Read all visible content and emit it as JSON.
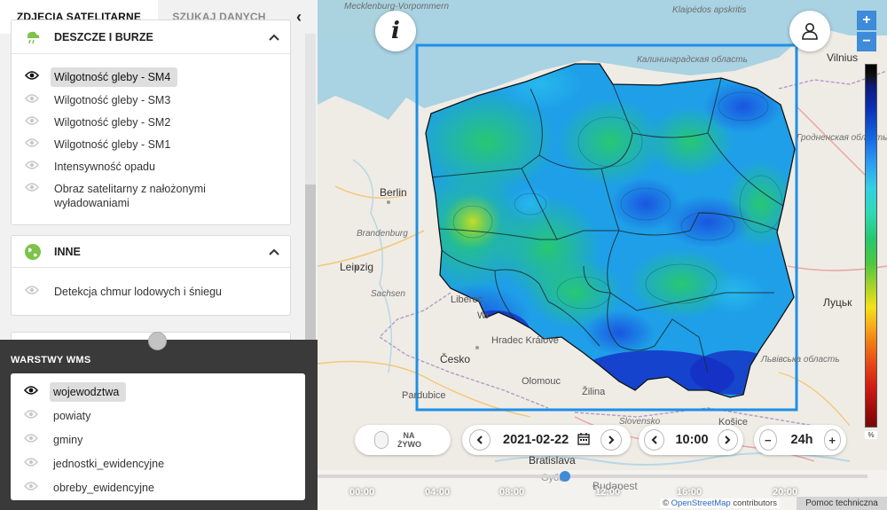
{
  "tabs": {
    "satellite": "ZDJĘCIA SATELITARNE",
    "search": "SZUKAJ DANYCH",
    "collapse": "‹"
  },
  "sections": {
    "rain": {
      "title": "DESZCZE I BURZE",
      "icon": "rain-cloud-icon",
      "layers": [
        {
          "label": "Wilgotność gleby - SM4",
          "active": true
        },
        {
          "label": "Wilgotność gleby - SM3",
          "active": false
        },
        {
          "label": "Wilgotność gleby - SM2",
          "active": false
        },
        {
          "label": "Wilgotność gleby - SM1",
          "active": false
        },
        {
          "label": "Intensywność opadu",
          "active": false
        },
        {
          "label": "Obraz satelitarny z nałożonymi wyładowaniami",
          "active": false
        }
      ]
    },
    "other": {
      "title": "INNE",
      "icon": "globe-icon",
      "layers": [
        {
          "label": "Detekcja chmur lodowych i śniegu",
          "active": false
        }
      ]
    }
  },
  "wms": {
    "title": "WARSTWY WMS",
    "layers": [
      {
        "label": "wojewodztwa",
        "active": true
      },
      {
        "label": "powiaty",
        "active": false
      },
      {
        "label": "gminy",
        "active": false
      },
      {
        "label": "jednostki_ewidencyjne",
        "active": false
      },
      {
        "label": "obreby_ewidencyjne",
        "active": false
      }
    ]
  },
  "map": {
    "info_label": "i",
    "zoom_in": "+",
    "zoom_out": "−",
    "labels": {
      "berlin": "Berlin",
      "leipzig": "Leipzig",
      "cesko": "Česko",
      "bratislava": "Bratislava",
      "budapest": "Budapest",
      "vilnius": "Vilnius",
      "lutsk": "Луцьк",
      "brandenburg": "Brandenburg",
      "sachsen": "Sachsen",
      "mecklenburg": "Mecklenburg-Vorpommern",
      "kaliningrad": "Калининградская область",
      "klaipedos": "Klaipėdos apskritis",
      "grodno": "Гродненская область",
      "lviv": "Львівська область",
      "slovensko": "Slovensko",
      "hradec": "Hradec Králové",
      "zilina": "Žilina",
      "gyor": "Győr",
      "kosice": "Košice",
      "pardubice": "Pardubice",
      "olomouc": "Olomouc",
      "liberec": "Liberec",
      "wroclaw": "Wr"
    },
    "legend_unit": "%"
  },
  "controls": {
    "live": "NA ŻYWO",
    "date": "2021-02-22",
    "time": "10:00",
    "range": "24h"
  },
  "timeline": {
    "ticks": [
      "00:00",
      "04:00",
      "08:00",
      "12:00",
      "16:00",
      "20:00"
    ]
  },
  "footer": {
    "attribution_prefix": "© ",
    "attribution_link": "OpenStreetMap",
    "attribution_suffix": " contributors",
    "help": "Pomoc techniczna"
  }
}
